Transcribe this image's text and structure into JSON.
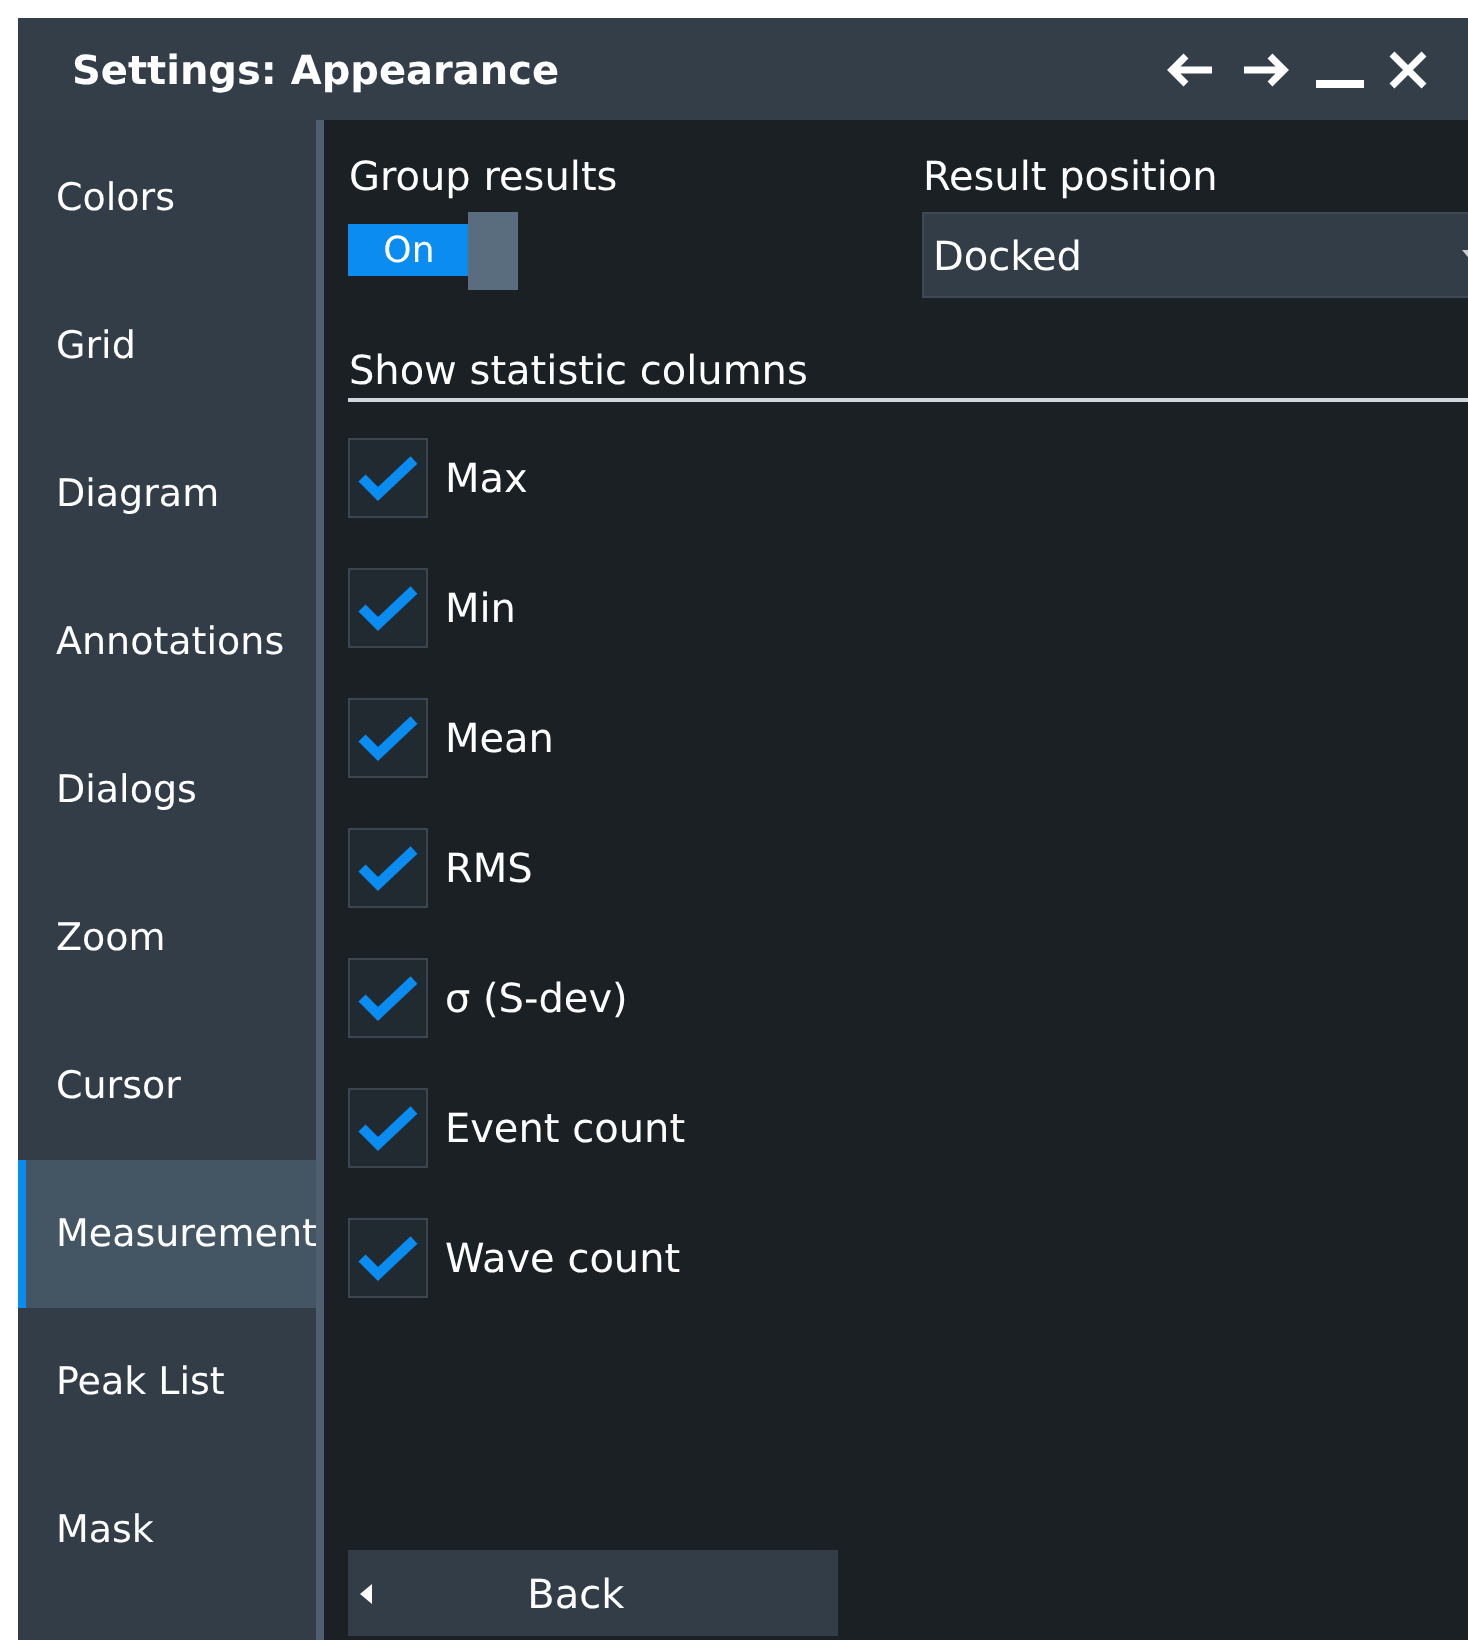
{
  "window": {
    "title": "Settings: Appearance"
  },
  "title_buttons": [
    {
      "kind": "back"
    },
    {
      "kind": "forward"
    },
    {
      "kind": "minimize"
    },
    {
      "kind": "close"
    }
  ],
  "sidebar": {
    "items": [
      {
        "label": "Colors",
        "selected": false
      },
      {
        "label": "Grid",
        "selected": false
      },
      {
        "label": "Diagram",
        "selected": false
      },
      {
        "label": "Annotations",
        "selected": false
      },
      {
        "label": "Dialogs",
        "selected": false
      },
      {
        "label": "Zoom",
        "selected": false
      },
      {
        "label": "Cursor",
        "selected": false
      },
      {
        "label": "Measurement",
        "selected": true
      },
      {
        "label": "Peak List",
        "selected": false
      },
      {
        "label": "Mask",
        "selected": false
      }
    ]
  },
  "group_results": {
    "label": "Group results",
    "toggle": "On",
    "on": true
  },
  "result_position": {
    "label": "Result position",
    "value": "Docked"
  },
  "statistic_columns": {
    "heading": "Show statistic columns",
    "items": [
      {
        "label": "Max",
        "checked": true
      },
      {
        "label": "Min",
        "checked": true
      },
      {
        "label": "Mean",
        "checked": true
      },
      {
        "label": "RMS",
        "checked": true
      },
      {
        "label": "σ (S-dev)",
        "checked": true
      },
      {
        "label": "Event count",
        "checked": true
      },
      {
        "label": "Wave count",
        "checked": true
      }
    ]
  },
  "back_button": {
    "label": "Back"
  }
}
